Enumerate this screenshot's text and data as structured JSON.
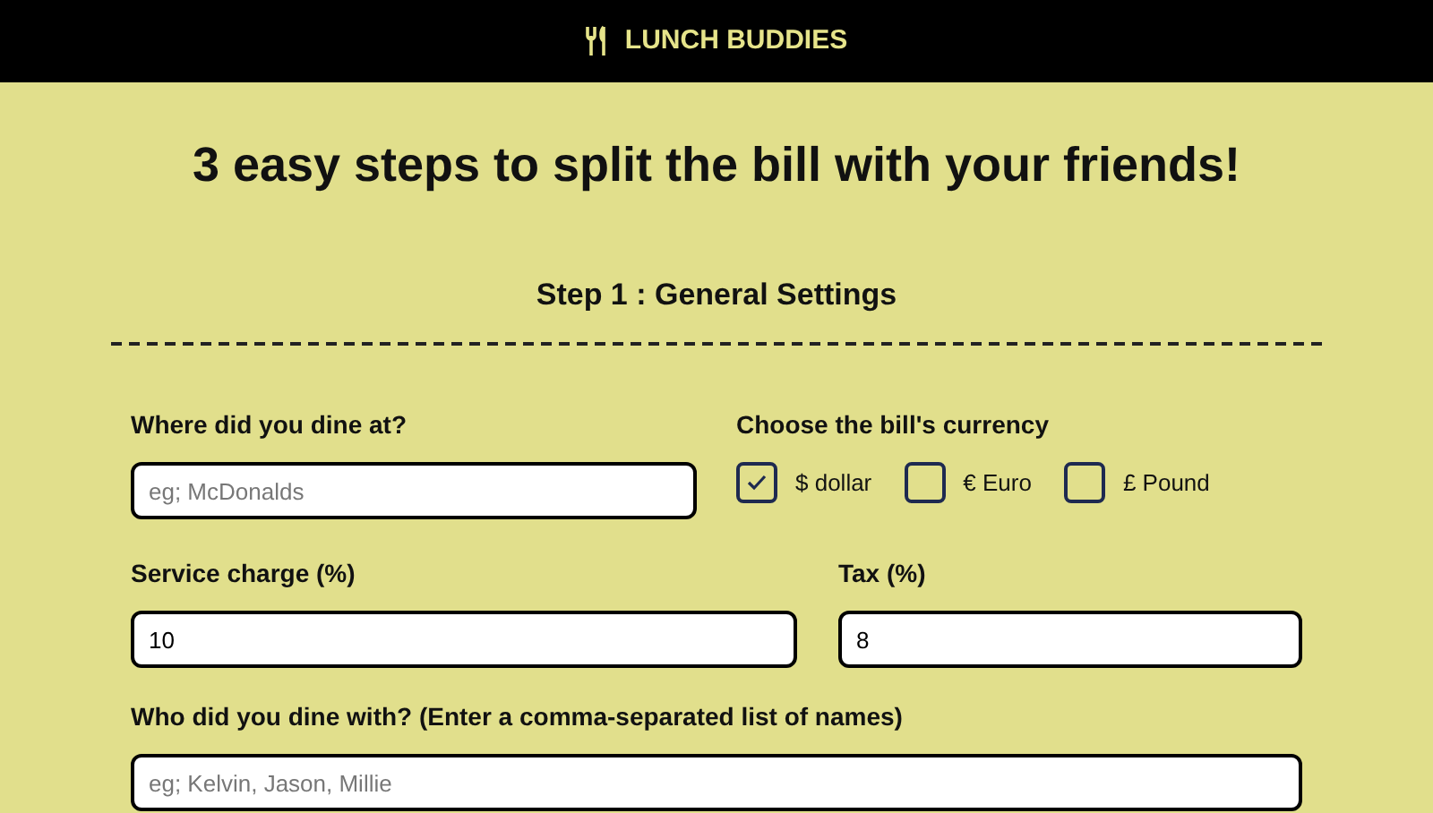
{
  "header": {
    "brand": "LUNCH BUDDIES"
  },
  "headline": "3 easy steps to split the bill with your friends!",
  "step_title": "Step 1 : General Settings",
  "venue": {
    "label": "Where did you dine at?",
    "placeholder": "eg; McDonalds"
  },
  "currency": {
    "label": "Choose the bill's currency",
    "options": [
      {
        "label": "$ dollar",
        "checked": true
      },
      {
        "label": "€ Euro",
        "checked": false
      },
      {
        "label": "£ Pound",
        "checked": false
      }
    ]
  },
  "service_charge": {
    "label": "Service charge (%)",
    "value": "10"
  },
  "tax": {
    "label": "Tax (%)",
    "value": "8"
  },
  "friends": {
    "label": "Who did you dine with? (Enter a comma-separated list of names)",
    "placeholder": "eg; Kelvin, Jason, Millie"
  }
}
